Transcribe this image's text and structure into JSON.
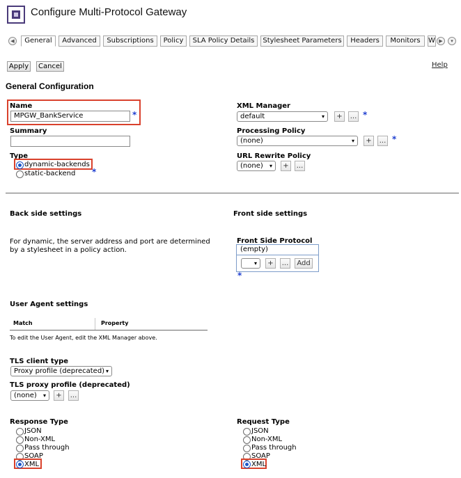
{
  "header": {
    "title": "Configure Multi-Protocol Gateway"
  },
  "tabs": [
    {
      "label": "General",
      "active": true
    },
    {
      "label": "Advanced"
    },
    {
      "label": "Subscriptions"
    },
    {
      "label": "Policy"
    },
    {
      "label": "SLA Policy Details"
    },
    {
      "label": "Stylesheet Parameters"
    },
    {
      "label": "Headers"
    },
    {
      "label": "Monitors"
    },
    {
      "label": "W"
    }
  ],
  "tab_nav": {
    "prev_glyph": "◀",
    "next_glyph": "▶",
    "more_glyph": "▾"
  },
  "toolbar": {
    "apply_label": "Apply",
    "cancel_label": "Cancel",
    "help_label": "Help"
  },
  "general": {
    "section_title": "General Configuration",
    "name_label": "Name",
    "name_value": "MPGW_BankService",
    "summary_label": "Summary",
    "summary_value": "",
    "type_label": "Type",
    "type_options": [
      "dynamic-backends",
      "static-backend"
    ],
    "type_selected": "dynamic-backends",
    "xml_manager_label": "XML Manager",
    "xml_manager_value": "default",
    "processing_policy_label": "Processing Policy",
    "processing_policy_value": "(none)",
    "url_rewrite_label": "URL Rewrite Policy",
    "url_rewrite_value": "(none)",
    "required_marker": "*",
    "add_glyph": "+",
    "edit_glyph": "..."
  },
  "back_side": {
    "title": "Back side settings",
    "description": "For dynamic, the server address and port are determined by a stylesheet in a policy action."
  },
  "front_side": {
    "title": "Front side settings",
    "protocol_label": "Front Side Protocol",
    "protocol_list_value": "(empty)",
    "add_button_label": "Add"
  },
  "user_agent": {
    "title": "User Agent settings",
    "columns": [
      "Match",
      "Property"
    ],
    "note": "To edit the User Agent, edit the XML Manager above."
  },
  "tls": {
    "client_type_label": "TLS client type",
    "client_type_value": "Proxy profile (deprecated)",
    "proxy_profile_label": "TLS proxy profile (deprecated)",
    "proxy_profile_value": "(none)"
  },
  "response_type": {
    "label": "Response Type",
    "options": [
      "JSON",
      "Non-XML",
      "Pass through",
      "SOAP",
      "XML"
    ],
    "selected": "XML"
  },
  "request_type": {
    "label": "Request Type",
    "options": [
      "JSON",
      "Non-XML",
      "Pass through",
      "SOAP",
      "XML"
    ],
    "selected": "XML"
  },
  "colors": {
    "accent_blue": "#1f3fd0",
    "highlight_red": "#d9412c",
    "title_icon": "#4a3a7a"
  }
}
